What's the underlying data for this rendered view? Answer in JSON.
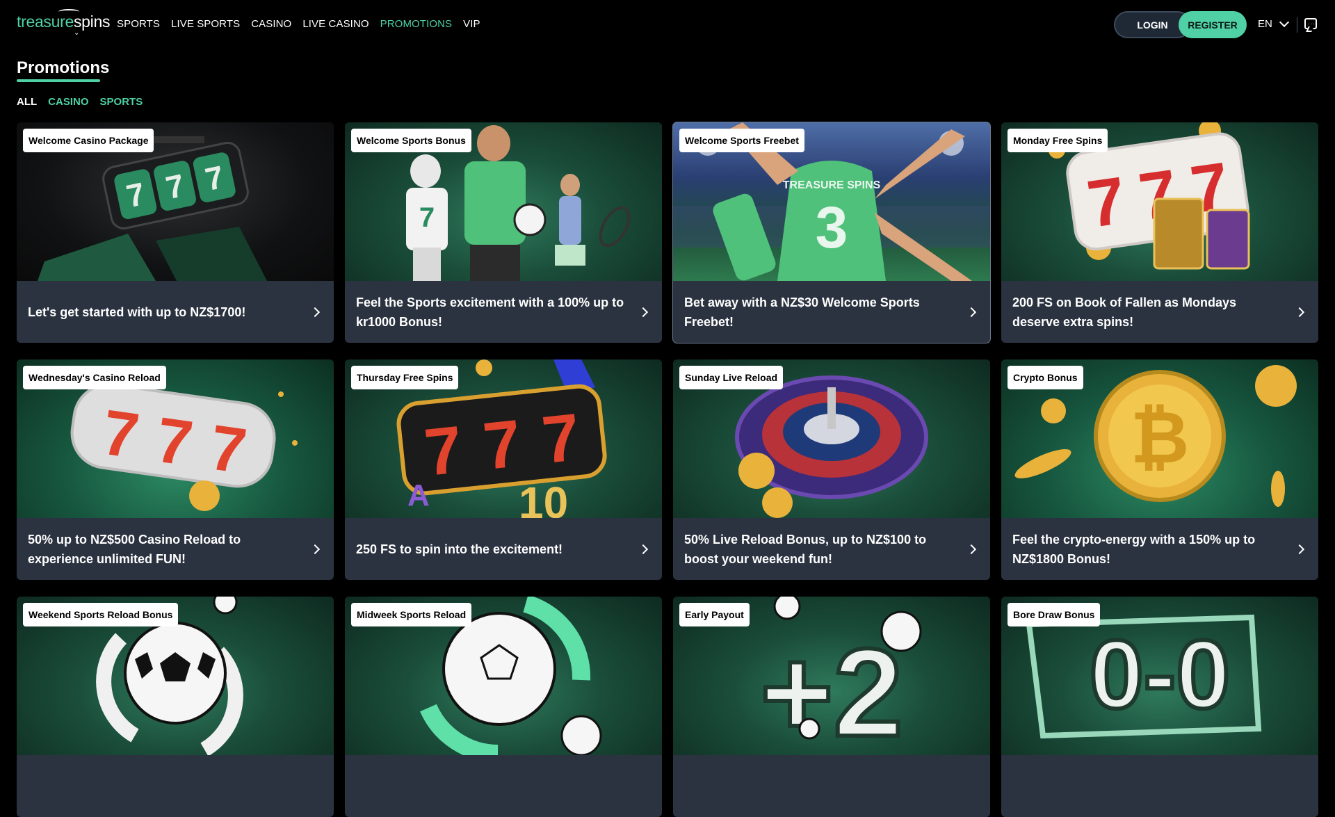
{
  "brand": {
    "logo_part1": "treasure",
    "logo_part2": "spins",
    "accent": "#4fd1a5"
  },
  "nav": [
    {
      "label": "SPORTS",
      "active": false
    },
    {
      "label": "LIVE SPORTS",
      "active": false
    },
    {
      "label": "CASINO",
      "active": false
    },
    {
      "label": "LIVE CASINO",
      "active": false
    },
    {
      "label": "PROMOTIONS",
      "active": true
    },
    {
      "label": "VIP",
      "active": false
    }
  ],
  "header": {
    "login_label": "LOGIN",
    "register_label": "REGISTER",
    "language": "EN"
  },
  "page": {
    "title": "Promotions"
  },
  "filters": [
    {
      "label": "ALL",
      "active": true
    },
    {
      "label": "CASINO",
      "active": false
    },
    {
      "label": "SPORTS",
      "active": false
    }
  ],
  "promotions": [
    {
      "badge": "Welcome Casino Package",
      "text": "Let's get started with up to NZ$1700!",
      "image": "slot-777-dark"
    },
    {
      "badge": "Welcome Sports Bonus",
      "text": "Feel the Sports excitement with a 100% up to kr1000 Bonus!",
      "image": "athletes"
    },
    {
      "badge": "Welcome Sports Freebet",
      "text": "Bet away with a NZ$30 Welcome Sports Freebet!",
      "image": "football-player-3",
      "jersey_text": "TREASURE SPINS",
      "jersey_number": "3"
    },
    {
      "badge": "Monday Free Spins",
      "text": "200 FS on Book of Fallen as Mondays deserve extra spins!",
      "image": "slot-777-pharaoh"
    },
    {
      "badge": "Wednesday's Casino Reload",
      "text": "50% up to NZ$500 Casino Reload to experience unlimited FUN!",
      "image": "slot-777-silver"
    },
    {
      "badge": "Thursday Free Spins",
      "text": "250 FS to spin into the excitement!",
      "image": "slot-777-gold"
    },
    {
      "badge": "Sunday Live Reload",
      "text": "50% Live Reload Bonus, up to NZ$100 to boost your weekend fun!",
      "image": "roulette"
    },
    {
      "badge": "Crypto Bonus",
      "text": "Feel the crypto-energy with a 150% up to NZ$1800 Bonus!",
      "image": "bitcoin-coin"
    },
    {
      "badge": "Weekend Sports Reload Bonus",
      "text": "",
      "image": "football-reload"
    },
    {
      "badge": "Midweek Sports Reload",
      "text": "",
      "image": "football-arrows"
    },
    {
      "badge": "Early Payout",
      "text": "",
      "image": "plus-two",
      "graphic_text": "+2"
    },
    {
      "badge": "Bore Draw Bonus",
      "text": "",
      "image": "zero-zero",
      "graphic_text": "0-0"
    }
  ]
}
